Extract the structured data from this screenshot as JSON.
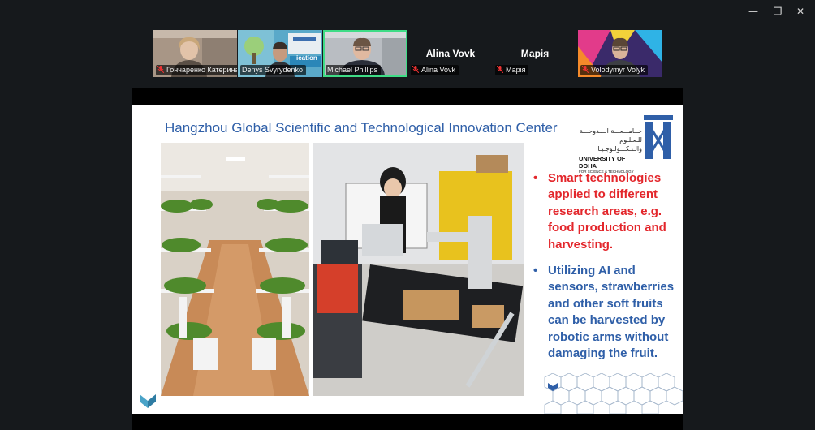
{
  "window": {
    "minimize_glyph": "—",
    "restore_glyph": "❐",
    "close_glyph": "✕"
  },
  "participants": [
    {
      "name": "Гончаренко Катерина...",
      "video": true
    },
    {
      "name": "Denys Svyrydenko",
      "video": true
    },
    {
      "name": "Michael Phillips",
      "video": true,
      "active_speaker": true
    },
    {
      "name": "Alina Vovk",
      "video": false
    },
    {
      "name": "Марія",
      "video": false
    },
    {
      "name": "Volodymyr Volyk",
      "video": true
    }
  ],
  "participant_badge": {
    "poster": "ication"
  },
  "slide": {
    "title": "Hangzhou Global Scientific and Technological Innovation Center",
    "bullet_dot": "•",
    "bullets": [
      {
        "text": "Smart technologies applied to different research areas, e.g. food production and harvesting.",
        "color": "#e3262b"
      },
      {
        "text": "Utilizing AI and sensors, strawberries and other soft fruits can be harvested by robotic arms without damaging the fruit.",
        "color": "#2f5fa8"
      }
    ],
    "university": {
      "arabic_line1": "جــامـــعـــة الـــدوحـــة",
      "arabic_line2": "للـعـلـوم والـتـكـنـولـوجـيـا",
      "english": "UNIVERSITY OF DOHA",
      "english_sub": "FOR SCIENCE & TECHNOLOGY"
    },
    "colors": {
      "title": "#2f5fa8",
      "accent": "#4aa3c8",
      "red": "#e3262b"
    }
  }
}
